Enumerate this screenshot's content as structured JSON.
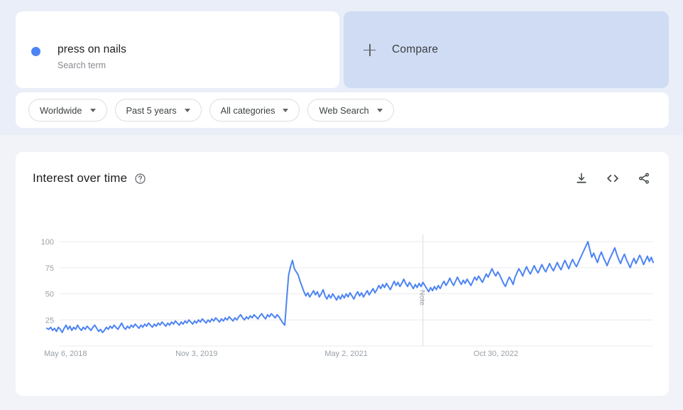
{
  "theme": {
    "accent": "#4d84f3",
    "header_band": "#e9eef8",
    "page_bg": "#f1f3f8",
    "compare_bg": "#cfdcf3",
    "card_bg": "#ffffff",
    "grid": "#ebebeb",
    "muted_text": "#9aa0a6"
  },
  "search_term": {
    "title": "press on nails",
    "subtitle": "Search term",
    "dot_color": "#4d84f3"
  },
  "compare": {
    "label": "Compare",
    "icon": "plus-icon"
  },
  "filters": [
    {
      "label": "Worldwide",
      "icon": "chevron-down-icon"
    },
    {
      "label": "Past 5 years",
      "icon": "chevron-down-icon"
    },
    {
      "label": "All categories",
      "icon": "chevron-down-icon"
    },
    {
      "label": "Web Search",
      "icon": "chevron-down-icon"
    }
  ],
  "chart_panel": {
    "title": "Interest over time",
    "help_icon": "help-circle-icon",
    "actions": [
      {
        "name": "download-button",
        "icon": "download-icon"
      },
      {
        "name": "embed-button",
        "icon": "code-brackets-icon",
        "glyph": "<>"
      },
      {
        "name": "share-button",
        "icon": "share-icon"
      }
    ]
  },
  "chart_data": {
    "type": "line",
    "title": "Interest over time",
    "xlabel": "",
    "ylabel": "",
    "ylim": [
      0,
      100
    ],
    "grid": true,
    "legend": false,
    "y_ticks": [
      100,
      75,
      50,
      25
    ],
    "x_tick_labels": [
      "May 6, 2018",
      "Nov 3, 2019",
      "May 2, 2021",
      "Oct 30, 2022"
    ],
    "x_tick_indices": [
      0,
      78,
      156,
      234
    ],
    "annotations": [
      {
        "label": "Note",
        "x_index": 196
      }
    ],
    "series": [
      {
        "name": "press on nails",
        "color": "#4d84f3",
        "values": [
          17,
          16,
          18,
          15,
          17,
          14,
          18,
          16,
          13,
          17,
          20,
          16,
          19,
          15,
          18,
          16,
          20,
          17,
          15,
          18,
          16,
          19,
          17,
          15,
          18,
          20,
          17,
          14,
          16,
          13,
          15,
          18,
          16,
          19,
          17,
          20,
          18,
          16,
          19,
          22,
          18,
          16,
          19,
          17,
          20,
          18,
          21,
          19,
          17,
          20,
          18,
          21,
          19,
          22,
          20,
          18,
          21,
          19,
          22,
          20,
          23,
          21,
          19,
          22,
          20,
          23,
          21,
          24,
          22,
          20,
          23,
          21,
          24,
          22,
          25,
          23,
          21,
          24,
          22,
          25,
          23,
          26,
          24,
          22,
          25,
          23,
          26,
          24,
          27,
          25,
          23,
          26,
          24,
          27,
          25,
          28,
          26,
          24,
          27,
          25,
          28,
          30,
          27,
          25,
          28,
          26,
          29,
          27,
          30,
          28,
          26,
          29,
          31,
          28,
          26,
          30,
          28,
          31,
          29,
          27,
          30,
          28,
          25,
          22,
          20,
          45,
          68,
          76,
          82,
          74,
          71,
          68,
          62,
          57,
          52,
          48,
          51,
          47,
          50,
          53,
          49,
          52,
          47,
          50,
          54,
          48,
          45,
          49,
          46,
          50,
          47,
          44,
          48,
          45,
          49,
          46,
          50,
          47,
          51,
          48,
          45,
          49,
          52,
          48,
          51,
          47,
          50,
          53,
          49,
          52,
          55,
          51,
          54,
          58,
          55,
          59,
          56,
          60,
          57,
          54,
          58,
          62,
          58,
          61,
          57,
          60,
          64,
          60,
          57,
          61,
          58,
          55,
          59,
          56,
          60,
          57,
          61,
          58,
          55,
          52,
          56,
          53,
          57,
          54,
          58,
          55,
          59,
          62,
          58,
          61,
          65,
          61,
          58,
          62,
          66,
          62,
          59,
          63,
          60,
          64,
          61,
          58,
          62,
          66,
          63,
          67,
          64,
          61,
          65,
          69,
          66,
          70,
          74,
          70,
          67,
          71,
          68,
          64,
          60,
          57,
          62,
          66,
          63,
          59,
          66,
          70,
          74,
          71,
          67,
          72,
          76,
          72,
          69,
          73,
          77,
          73,
          70,
          74,
          78,
          74,
          71,
          75,
          79,
          75,
          72,
          76,
          80,
          76,
          73,
          78,
          82,
          78,
          74,
          79,
          83,
          79,
          76,
          80,
          84,
          88,
          92,
          96,
          100,
          92,
          85,
          89,
          84,
          80,
          86,
          90,
          85,
          81,
          77,
          82,
          86,
          90,
          94,
          88,
          83,
          79,
          84,
          88,
          83,
          79,
          75,
          80,
          84,
          79,
          83,
          87,
          83,
          78,
          82,
          86,
          81,
          85,
          80
        ]
      }
    ]
  }
}
